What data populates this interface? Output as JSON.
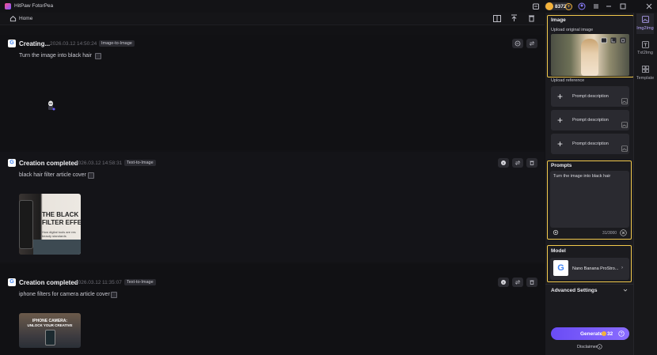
{
  "app": {
    "title": "HitPaw FotorPea",
    "credits": "8372"
  },
  "nav": {
    "home_label": "Home"
  },
  "feed": [
    {
      "status": "Creating...",
      "date": "2026.03.12",
      "time": "14:50:24",
      "type_tag": "Image-to-Image",
      "prompt": "Turn the image into black hair"
    },
    {
      "status": "Creation completed",
      "date": "2026.03.12",
      "time": "14:58:31",
      "type_tag": "Text-to-Image",
      "prompt": "black hair filter article cover",
      "thumb_text_1": "THE BLACK H",
      "thumb_text_2": "FILTER EFFE",
      "thumb_text_3": "How digital tools are res",
      "thumb_text_4": "beauty standards"
    },
    {
      "status": "Creation completed",
      "date": "2026.03.12",
      "time": "11:35:07",
      "type_tag": "Text-to-Image",
      "prompt": "iphone filters for camera article cover",
      "thumb_text_1": "IPHONE CAMERA:",
      "thumb_text_2": "UNLOCK YOUR CREATIVE"
    }
  ],
  "panel": {
    "image_title": "Image",
    "upload_original": "Upload original image",
    "upload_reference": "Upload reference",
    "reference_items": [
      "Prompt description",
      "Prompt description",
      "Prompt description"
    ],
    "prompts_title": "Prompts",
    "prompt_text": "Turn the image into black hair",
    "char_count": "31/3000",
    "model_title": "Model",
    "model_name": "Nano Banana ProStro...",
    "advanced_label": "Advanced Settings",
    "generate_label": "Generate",
    "generate_cost": "32",
    "disclaimer": "Disclaimer"
  },
  "rail": {
    "items": [
      "Img2Img",
      "Txt2Img",
      "Template"
    ]
  },
  "colors": {
    "accent": "#7b5cff",
    "highlight": "#f2c94c",
    "coin": "#f3b23c"
  }
}
